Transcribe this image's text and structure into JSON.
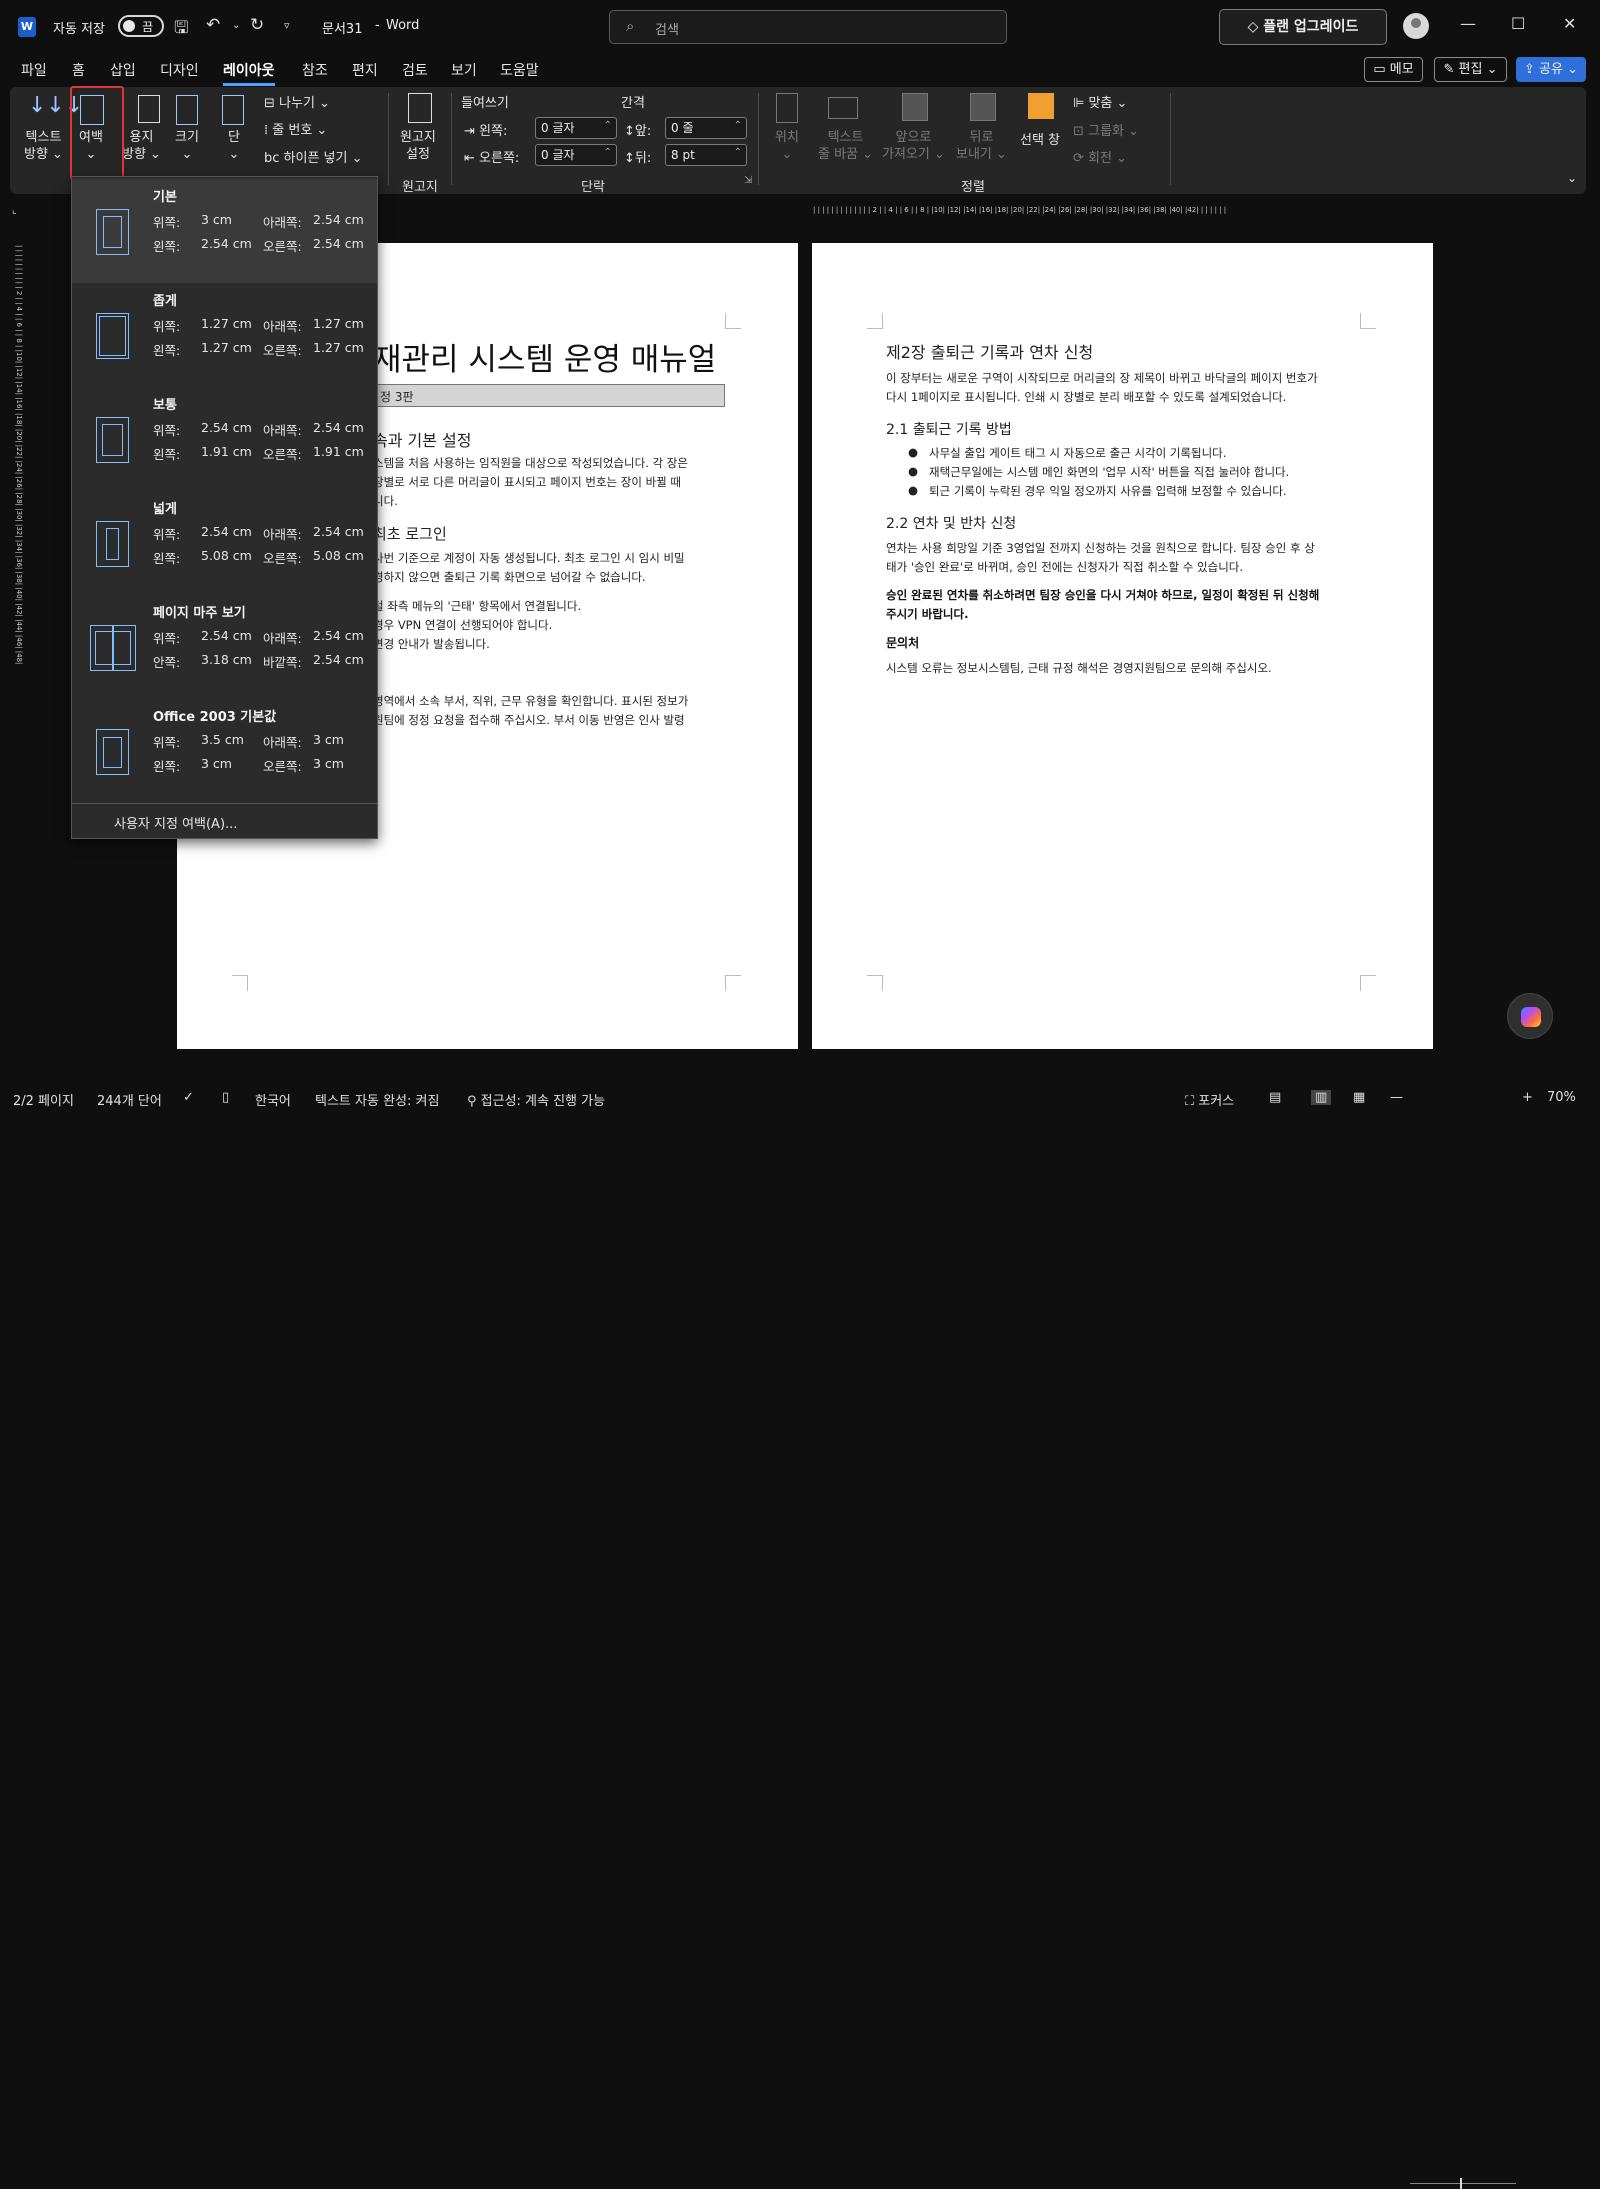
{
  "titlebar": {
    "autosave_label": "자동 저장",
    "autosave_state": "끔",
    "doc_title": "문서31",
    "title_sep": "-",
    "app_name": "Word",
    "search_placeholder": "검색",
    "upgrade_label": "플랜 업그레이드"
  },
  "tabs": [
    "파일",
    "홈",
    "삽입",
    "디자인",
    "레이아웃",
    "참조",
    "편지",
    "검토",
    "보기",
    "도움말"
  ],
  "active_tab": "레이아웃",
  "tab_buttons": {
    "memo": "메모",
    "edit": "편집",
    "share": "공유"
  },
  "ribbon": {
    "text_dir": [
      "텍스트",
      "방향"
    ],
    "margins": "여백",
    "orientation": [
      "용지",
      "방향"
    ],
    "size": "크기",
    "columns": "단",
    "breaks": "나누기",
    "line_numbers": "줄 번호",
    "hyphenation": "하이픈 넣기",
    "manuscript": [
      "원고지",
      "설정"
    ],
    "group_manuscript": "원고지",
    "indent_label": "들여쓰기",
    "spacing_label": "간격",
    "left_label": "왼쪽:",
    "right_label": "오른쪽:",
    "before_label": "앞:",
    "after_label": "뒤:",
    "indent_left": "0 글자",
    "indent_right": "0 글자",
    "space_before": "0 줄",
    "space_after": "8 pt",
    "group_paragraph": "단락",
    "position": "위치",
    "wrap_text": [
      "텍스트",
      "줄 바꿈"
    ],
    "bring_forward": [
      "앞으로",
      "가져오기"
    ],
    "send_backward": [
      "뒤로",
      "보내기"
    ],
    "selection_pane": "선택 창",
    "align": "맞춤",
    "group": "그룹화",
    "rotate": "회전",
    "group_arrange": "정렬"
  },
  "margins_menu": {
    "options": [
      {
        "name": "기본",
        "top_l": "위쪽:",
        "top": "3 cm",
        "bottom_l": "아래쪽:",
        "bottom": "2.54 cm",
        "left_l": "왼쪽:",
        "left": "2.54 cm",
        "right_l": "오른쪽:",
        "right": "2.54 cm"
      },
      {
        "name": "좁게",
        "top_l": "위쪽:",
        "top": "1.27 cm",
        "bottom_l": "아래쪽:",
        "bottom": "1.27 cm",
        "left_l": "왼쪽:",
        "left": "1.27 cm",
        "right_l": "오른쪽:",
        "right": "1.27 cm"
      },
      {
        "name": "보통",
        "top_l": "위쪽:",
        "top": "2.54 cm",
        "bottom_l": "아래쪽:",
        "bottom": "2.54 cm",
        "left_l": "왼쪽:",
        "left": "1.91 cm",
        "right_l": "오른쪽:",
        "right": "1.91 cm"
      },
      {
        "name": "넓게",
        "top_l": "위쪽:",
        "top": "2.54 cm",
        "bottom_l": "아래쪽:",
        "bottom": "2.54 cm",
        "left_l": "왼쪽:",
        "left": "5.08 cm",
        "right_l": "오른쪽:",
        "right": "5.08 cm"
      },
      {
        "name": "페이지 마주 보기",
        "top_l": "위쪽:",
        "top": "2.54 cm",
        "bottom_l": "아래쪽:",
        "bottom": "2.54 cm",
        "left_l": "안쪽:",
        "left": "3.18 cm",
        "right_l": "바깥쪽:",
        "right": "2.54 cm"
      },
      {
        "name": "Office 2003 기본값",
        "top_l": "위쪽:",
        "top": "3.5 cm",
        "bottom_l": "아래쪽:",
        "bottom": "3 cm",
        "left_l": "왼쪽:",
        "left": "3 cm",
        "right_l": "오른쪽:",
        "right": "3 cm"
      }
    ],
    "custom": "사용자 지정 여백(A)..."
  },
  "ruler_h": "| | | | | | | | | | | |  | 2 |  | 4 |  | 6 |  | 8 |  |10|  |12|  |14|  |16|  |18|  |20|  |22|  |24|  |26|  |28|  |30|  |32|  |34|  |36|  |38|  |40|  |42|  | | | | | |",
  "ruler_v": "| | | | | | | | | | 2 | | 4 | | 6 | | 8 | |10| |12| |14| |16| |18| |20| |22| |24| |26| |28| |30| |32| |34| |36| |38| |40| |42| |44| |46| |48|",
  "page1": {
    "title": "재관리 시스템 운영 매뉴얼",
    "subtitle": "정 3판",
    "h1": "속과 기본 설정",
    "p1": [
      "스템을 처음 사용하는 임직원을 대상으로 작성되었습니다. 각 장은",
      "장별로 서로 다른 머리글이 표시되고 페이지 번호는 장이 바뀔 때",
      "니다."
    ],
    "h2": "최초 로그인",
    "p2": [
      "사번 기준으로 계정이 자동 생성됩니다. 최초 로그인 시 임시 비밀",
      "경하지 않으면 출퇴근 기록 화면으로 넘어갈 수 없습니다."
    ],
    "p3": [
      "털 좌측 메뉴의 '근태' 항목에서 연결됩니다.",
      "경우 VPN 연결이 선행되어야 합니다.",
      "변경 안내가 발송됩니다."
    ],
    "p4": [
      "영역에서 소속 부서, 직위, 근무 유형을 확인합니다. 표시된 정보가",
      "원팀에 정정 요청을 접수해 주십시오. 부서 이동 반영은 인사 발령"
    ]
  },
  "page2": {
    "title": "제2장 출퇴근 기록과 연차 신청",
    "p1": [
      "이 장부터는 새로운 구역이 시작되므로 머리글의 장 제목이 바뀌고 바닥글의 페이지 번호가",
      "다시 1페이지로 표시됩니다. 인쇄 시 장별로 분리 배포할 수 있도록 설계되었습니다."
    ],
    "h1": "2.1 출퇴근 기록 방법",
    "bullets": [
      "사무실 출입 게이트 태그 시 자동으로 출근 시각이 기록됩니다.",
      "재택근무일에는 시스템 메인 화면의 '업무 시작' 버튼을 직접 눌러야 합니다.",
      "퇴근 기록이 누락된 경우 익일 정오까지 사유를 입력해 보정할 수 있습니다."
    ],
    "h2": "2.2 연차 및 반차 신청",
    "p2": [
      "연차는 사용 희망일 기준 3영업일 전까지 신청하는 것을 원칙으로 합니다. 팀장 승인 후 상",
      "태가 '승인 완료'로 바뀌며, 승인 전에는 신청자가 직접 취소할 수 있습니다."
    ],
    "bold": [
      "승인 완료된 연차를 취소하려면 팀장 승인을 다시 거쳐야 하므로, 일정이 확정된 뒤 신청해",
      "주시기 바랍니다."
    ],
    "h3": "문의처",
    "p3": "시스템 오류는 정보시스템팀, 근태 규정 해석은 경영지원팀으로 문의해 주십시오."
  },
  "status": {
    "page": "2/2 페이지",
    "words": "244개 단어",
    "lang": "한국어",
    "autocomplete": "텍스트 자동 완성: 켜짐",
    "accessibility": "접근성: 계속 진행 가능",
    "focus": "포커스",
    "zoom": "70%"
  }
}
